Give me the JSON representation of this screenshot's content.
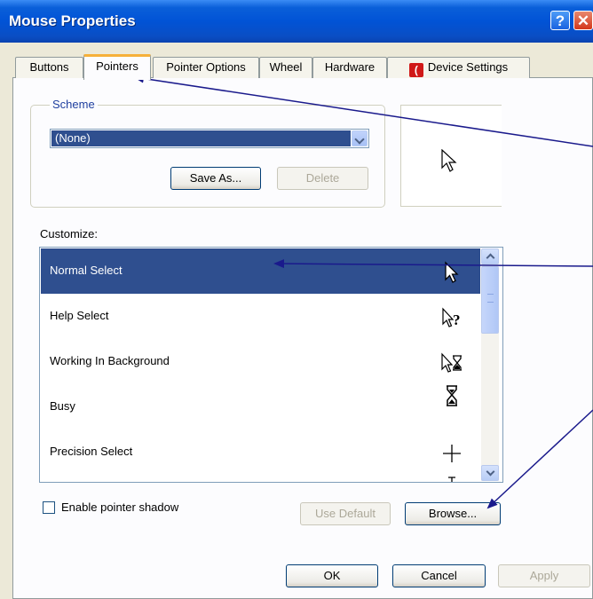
{
  "window": {
    "title": "Mouse Properties"
  },
  "titlebar": {
    "help_glyph": "?",
    "close_glyph": "✕"
  },
  "tabs": [
    {
      "label": "Buttons"
    },
    {
      "label": "Pointers",
      "active": true
    },
    {
      "label": "Pointer Options"
    },
    {
      "label": "Wheel"
    },
    {
      "label": "Hardware"
    },
    {
      "label": "Device Settings"
    }
  ],
  "scheme": {
    "group_label": "Scheme",
    "selected": "(None)",
    "save_as_label": "Save As...",
    "delete_label": "Delete"
  },
  "customize": {
    "label": "Customize:",
    "items": [
      {
        "name": "Normal Select",
        "icon": "arrow-cursor-icon",
        "selected": true
      },
      {
        "name": "Help Select",
        "icon": "help-cursor-icon"
      },
      {
        "name": "Working In Background",
        "icon": "working-cursor-icon"
      },
      {
        "name": "Busy",
        "icon": "hourglass-icon"
      },
      {
        "name": "Precision Select",
        "icon": "crosshair-icon"
      }
    ]
  },
  "options": {
    "pointer_shadow_label": "Enable pointer shadow",
    "pointer_shadow_checked": false,
    "use_default_label": "Use Default",
    "browse_label": "Browse..."
  },
  "footer": {
    "ok_label": "OK",
    "cancel_label": "Cancel",
    "apply_label": "Apply"
  },
  "colors": {
    "selection": "#2f4f8f",
    "annotation_arrow": "#1a1a8c",
    "titlebar": "#0153d6"
  }
}
